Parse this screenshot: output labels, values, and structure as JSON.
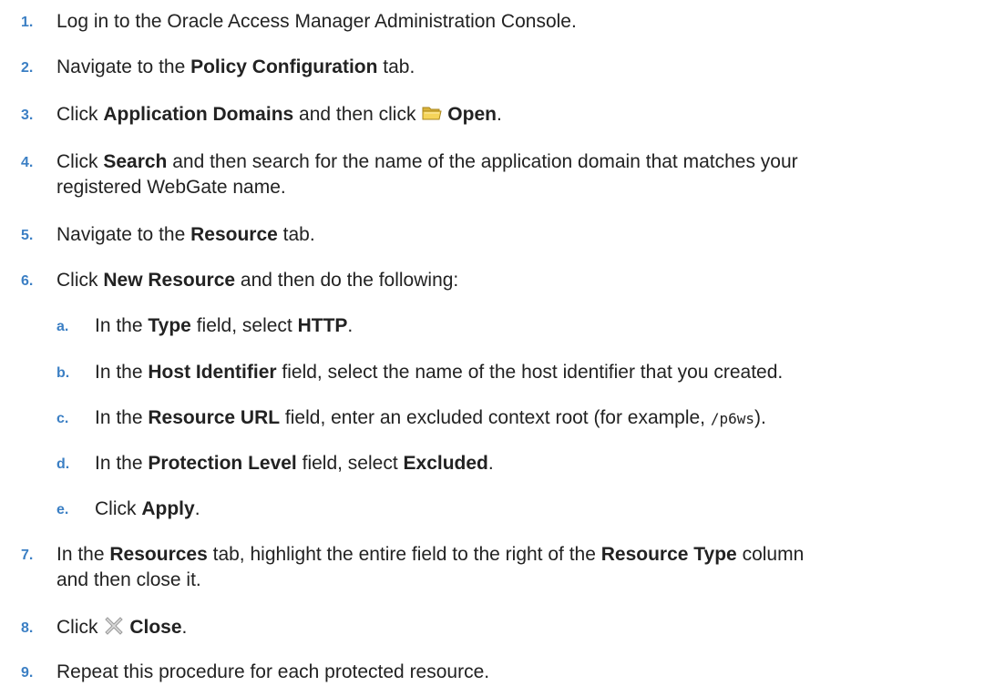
{
  "steps": [
    {
      "num": "1.",
      "text": "Log in to the Oracle Access Manager Administration Console."
    },
    {
      "num": "2.",
      "pre": "Navigate to the ",
      "b1": "Policy Configuration",
      "post": " tab."
    },
    {
      "num": "3.",
      "pre": "Click ",
      "b1": "Application Domains",
      "mid": " and then click ",
      "icon": "folder-open-icon",
      "b2": "Open",
      "post": "."
    },
    {
      "num": "4.",
      "pre": "Click ",
      "b1": "Search",
      "post": " and then search for the name of the application domain that matches your",
      "line2": "registered WebGate name."
    },
    {
      "num": "5.",
      "pre": "Navigate to the ",
      "b1": "Resource",
      "post": " tab."
    },
    {
      "num": "6.",
      "pre": "Click ",
      "b1": "New Resource",
      "post": " and then do the following:"
    },
    {
      "num": "7.",
      "pre": "In the ",
      "b1": "Resources",
      "mid": " tab, highlight the entire field to the right of the ",
      "b2": "Resource Type",
      "post": " column",
      "line2": "and then close it."
    },
    {
      "num": "8.",
      "pre": "Click ",
      "icon": "close-x-icon",
      "b1": "Close",
      "post": "."
    },
    {
      "num": "9.",
      "text": "Repeat this procedure for each protected resource."
    }
  ],
  "substeps": [
    {
      "num": "a.",
      "pre": "In the ",
      "b1": "Type",
      "mid": " field, select ",
      "b2": "HTTP",
      "post": "."
    },
    {
      "num": "b.",
      "pre": "In the ",
      "b1": "Host Identifier",
      "post": " field, select the name of the host identifier that you created."
    },
    {
      "num": "c.",
      "pre": "In the ",
      "b1": "Resource URL",
      "mid": " field, enter an excluded context root (for example, ",
      "code": "/p6ws",
      "post": ")."
    },
    {
      "num": "d.",
      "pre": "In the ",
      "b1": "Protection Level",
      "mid": " field, select ",
      "b2": "Excluded",
      "post": "."
    },
    {
      "num": "e.",
      "pre": "Click ",
      "b1": "Apply",
      "post": "."
    }
  ],
  "colors": {
    "number": "#3b7fc4",
    "text": "#222222",
    "background": "#ffffff"
  }
}
